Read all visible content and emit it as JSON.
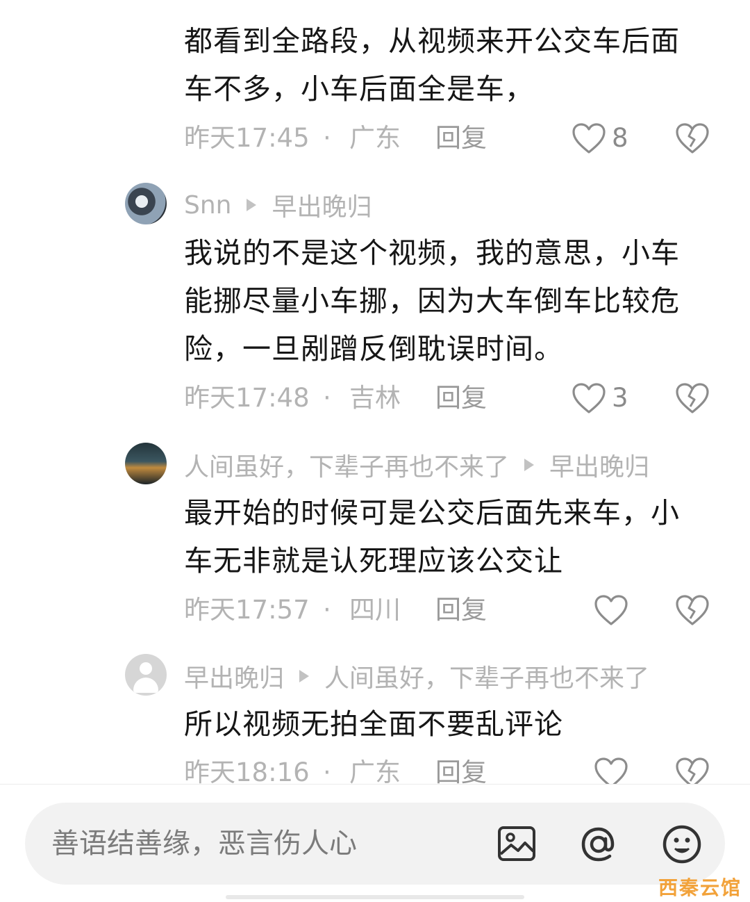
{
  "comments": [
    {
      "text_lines": [
        "都看到全路段，从视频来开公交车后面",
        "车不多，小车后面全是车，"
      ],
      "time": "昨天17:45",
      "dot": "·",
      "region": "广东",
      "reply": "回复",
      "likes": "8"
    },
    {
      "author": "Snn",
      "reply_to": "早出晚归",
      "text_lines": [
        "我说的不是这个视频，我的意思，小车",
        "能挪尽量小车挪，因为大车倒车比较危",
        "险，一旦剐蹭反倒耽误时间。"
      ],
      "time": "昨天17:48",
      "dot": "·",
      "region": "吉林",
      "reply": "回复",
      "likes": "3"
    },
    {
      "author": "人间虽好，下辈子再也不来了",
      "reply_to": "早出晚归",
      "text_lines": [
        "最开始的时候可是公交后面先来车，小",
        "车无非就是认死理应该公交让"
      ],
      "time": "昨天17:57",
      "dot": "·",
      "region": "四川",
      "reply": "回复",
      "likes": ""
    },
    {
      "author": "早出晚归",
      "reply_to": "人间虽好，下辈子再也不来了",
      "text_lines": [
        "所以视频无拍全面不要乱评论"
      ],
      "time": "昨天18:16",
      "dot": "·",
      "region": "广东",
      "reply": "回复",
      "likes": ""
    }
  ],
  "input": {
    "placeholder": "善语结善缘，恶言伤人心"
  },
  "icons": {
    "like": "heart-outline-icon",
    "dislike": "broken-heart-icon",
    "reply_arrow": "triangle-right-icon",
    "image": "image-icon",
    "mention": "at-icon",
    "emoji": "emoji-icon"
  },
  "watermark": "西秦云馆",
  "colors": {
    "text_primary": "#161616",
    "text_secondary": "#b3b3b3",
    "input_bg": "#f2f2f2"
  }
}
